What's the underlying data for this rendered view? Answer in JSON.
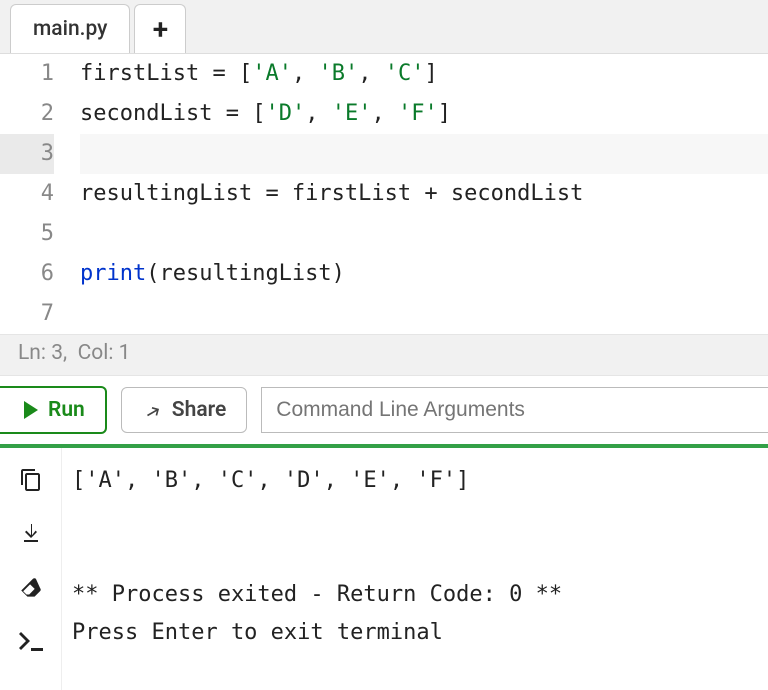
{
  "tabs": {
    "active": "main.py",
    "add_label": "+"
  },
  "code": {
    "lines": [
      {
        "n": 1,
        "segments": [
          {
            "t": "firstList ",
            "c": ""
          },
          {
            "t": "=",
            "c": "tok-op"
          },
          {
            "t": " [",
            "c": ""
          },
          {
            "t": "'A'",
            "c": "tok-str"
          },
          {
            "t": ", ",
            "c": ""
          },
          {
            "t": "'B'",
            "c": "tok-str"
          },
          {
            "t": ", ",
            "c": ""
          },
          {
            "t": "'C'",
            "c": "tok-str"
          },
          {
            "t": "]",
            "c": ""
          }
        ]
      },
      {
        "n": 2,
        "segments": [
          {
            "t": "secondList ",
            "c": ""
          },
          {
            "t": "=",
            "c": "tok-op"
          },
          {
            "t": " [",
            "c": ""
          },
          {
            "t": "'D'",
            "c": "tok-str"
          },
          {
            "t": ", ",
            "c": ""
          },
          {
            "t": "'E'",
            "c": "tok-str"
          },
          {
            "t": ", ",
            "c": ""
          },
          {
            "t": "'F'",
            "c": "tok-str"
          },
          {
            "t": "]",
            "c": ""
          }
        ]
      },
      {
        "n": 3,
        "active": true,
        "segments": []
      },
      {
        "n": 4,
        "segments": [
          {
            "t": "resultingList ",
            "c": ""
          },
          {
            "t": "=",
            "c": "tok-op"
          },
          {
            "t": " firstList ",
            "c": ""
          },
          {
            "t": "+",
            "c": "tok-op"
          },
          {
            "t": " secondList",
            "c": ""
          }
        ]
      },
      {
        "n": 5,
        "segments": []
      },
      {
        "n": 6,
        "segments": [
          {
            "t": "print",
            "c": "tok-kw"
          },
          {
            "t": "(resultingList)",
            "c": ""
          }
        ]
      },
      {
        "n": 7,
        "segments": []
      }
    ]
  },
  "status": {
    "ln": 3,
    "col": 1,
    "prefix_ln": "Ln: ",
    "prefix_col": "Col: "
  },
  "toolbar": {
    "run_label": "Run",
    "share_label": "Share",
    "cli_placeholder": "Command Line Arguments"
  },
  "sidebar_icons": {
    "copy": "copy-icon",
    "download": "download-icon",
    "erase": "erase-icon",
    "terminal": "terminal-icon"
  },
  "terminal": {
    "lines": [
      "['A', 'B', 'C', 'D', 'E', 'F']",
      "",
      "",
      "** Process exited - Return Code: 0 **",
      "Press Enter to exit terminal"
    ]
  }
}
